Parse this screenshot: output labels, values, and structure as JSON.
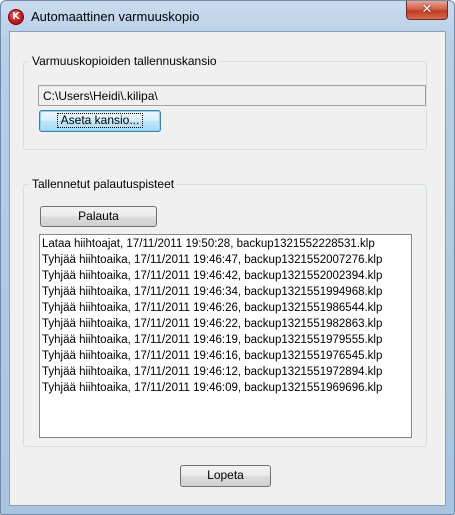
{
  "window": {
    "title": "Automaattinen varmuuskopio",
    "app_icon_glyph": "K",
    "close_glyph": "✕"
  },
  "backup_folder": {
    "group_label": "Varmuuskopioiden tallennuskansio",
    "path": "C:\\Users\\Heidi\\.kilipa\\",
    "set_folder_button": "Aseta kansio..."
  },
  "restore_points": {
    "group_label": "Tallennetut palautuspisteet",
    "restore_button": "Palauta",
    "items": [
      "Lataa hiihtoajat, 17/11/2011 19:50:28, backup1321552228531.klp",
      "Tyhjää hiihtoaika, 17/11/2011 19:46:47, backup1321552007276.klp",
      "Tyhjää hiihtoaika, 17/11/2011 19:46:42, backup1321552002394.klp",
      "Tyhjää hiihtoaika, 17/11/2011 19:46:34, backup1321551994968.klp",
      "Tyhjää hiihtoaika, 17/11/2011 19:46:26, backup1321551986544.klp",
      "Tyhjää hiihtoaika, 17/11/2011 19:46:22, backup1321551982863.klp",
      "Tyhjää hiihtoaika, 17/11/2011 19:46:19, backup1321551979555.klp",
      "Tyhjää hiihtoaika, 17/11/2011 19:46:16, backup1321551976545.klp",
      "Tyhjää hiihtoaika, 17/11/2011 19:46:12, backup1321551972894.klp",
      "Tyhjää hiihtoaika, 17/11/2011 19:46:09, backup1321551969696.klp"
    ]
  },
  "footer": {
    "quit_button": "Lopeta"
  }
}
